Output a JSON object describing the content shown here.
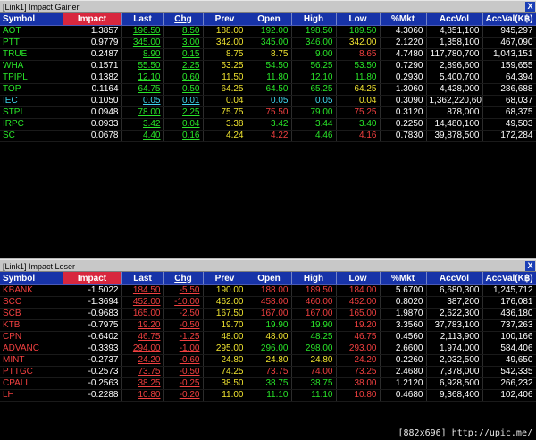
{
  "gainer": {
    "title": "[Link1] Impact Gainer",
    "close_label": "X",
    "columns": [
      "Symbol",
      "Impact",
      "Last",
      "Chg",
      "Prev",
      "Open",
      "High",
      "Low",
      "%Mkt",
      "AccVol",
      "AccVal(K฿)"
    ],
    "rows": [
      {
        "symbol": "AOT",
        "impact": "1.3857",
        "last": "196.50",
        "chg": "8.50",
        "prev": "188.00",
        "open": "192.00",
        "high": "198.50",
        "low": "189.50",
        "mkt": "4.3060",
        "vol": "4,851,100",
        "val": "945,297",
        "c": [
          "g",
          "w",
          "g",
          "g",
          "y",
          "g",
          "g",
          "g"
        ]
      },
      {
        "symbol": "PTT",
        "impact": "0.9779",
        "last": "345.00",
        "chg": "3.00",
        "prev": "342.00",
        "open": "345.00",
        "high": "346.00",
        "low": "342.00",
        "mkt": "2.1220",
        "vol": "1,358,100",
        "val": "467,090",
        "c": [
          "g",
          "w",
          "g",
          "g",
          "y",
          "g",
          "g",
          "y"
        ]
      },
      {
        "symbol": "TRUE",
        "impact": "0.2487",
        "last": "8.90",
        "chg": "0.15",
        "prev": "8.75",
        "open": "8.75",
        "high": "9.00",
        "low": "8.65",
        "mkt": "4.7480",
        "vol": "117,780,700",
        "val": "1,043,151",
        "c": [
          "g",
          "w",
          "g",
          "g",
          "y",
          "y",
          "g",
          "r"
        ]
      },
      {
        "symbol": "WHA",
        "impact": "0.1571",
        "last": "55.50",
        "chg": "2.25",
        "prev": "53.25",
        "open": "54.50",
        "high": "56.25",
        "low": "53.50",
        "mkt": "0.7290",
        "vol": "2,896,600",
        "val": "159,655",
        "c": [
          "g",
          "w",
          "g",
          "g",
          "y",
          "g",
          "g",
          "g"
        ]
      },
      {
        "symbol": "TPIPL",
        "impact": "0.1382",
        "last": "12.10",
        "chg": "0.60",
        "prev": "11.50",
        "open": "11.80",
        "high": "12.10",
        "low": "11.80",
        "mkt": "0.2930",
        "vol": "5,400,700",
        "val": "64,394",
        "c": [
          "g",
          "w",
          "g",
          "g",
          "y",
          "g",
          "g",
          "g"
        ]
      },
      {
        "symbol": "TOP",
        "impact": "0.1164",
        "last": "64.75",
        "chg": "0.50",
        "prev": "64.25",
        "open": "64.50",
        "high": "65.25",
        "low": "64.25",
        "mkt": "1.3060",
        "vol": "4,428,000",
        "val": "286,688",
        "c": [
          "g",
          "w",
          "g",
          "g",
          "y",
          "g",
          "g",
          "y"
        ]
      },
      {
        "symbol": "IEC",
        "impact": "0.1050",
        "last": "0.05",
        "chg": "0.01",
        "prev": "0.04",
        "open": "0.05",
        "high": "0.05",
        "low": "0.04",
        "mkt": "0.3090",
        "vol": "1,362,220,600",
        "val": "68,037",
        "c": [
          "c",
          "w",
          "c",
          "c",
          "y",
          "c",
          "c",
          "y"
        ]
      },
      {
        "symbol": "STPI",
        "impact": "0.0948",
        "last": "78.00",
        "chg": "2.25",
        "prev": "75.75",
        "open": "75.50",
        "high": "79.00",
        "low": "75.25",
        "mkt": "0.3120",
        "vol": "878,000",
        "val": "68,375",
        "c": [
          "g",
          "w",
          "g",
          "g",
          "y",
          "r",
          "g",
          "r"
        ]
      },
      {
        "symbol": "IRPC",
        "impact": "0.0933",
        "last": "3.42",
        "chg": "0.04",
        "prev": "3.38",
        "open": "3.42",
        "high": "3.44",
        "low": "3.40",
        "mkt": "0.2250",
        "vol": "14,480,100",
        "val": "49,503",
        "c": [
          "g",
          "w",
          "g",
          "g",
          "y",
          "g",
          "g",
          "g"
        ]
      },
      {
        "symbol": "SC",
        "impact": "0.0678",
        "last": "4.40",
        "chg": "0.16",
        "prev": "4.24",
        "open": "4.22",
        "high": "4.46",
        "low": "4.16",
        "mkt": "0.7830",
        "vol": "39,878,500",
        "val": "172,284",
        "c": [
          "g",
          "w",
          "g",
          "g",
          "y",
          "r",
          "g",
          "r"
        ]
      }
    ]
  },
  "loser": {
    "title": "[Link1] Impact Loser",
    "close_label": "X",
    "columns": [
      "Symbol",
      "Impact",
      "Last",
      "Chg",
      "Prev",
      "Open",
      "High",
      "Low",
      "%Mkt",
      "AccVol",
      "AccVal(K฿)"
    ],
    "rows": [
      {
        "symbol": "KBANK",
        "impact": "-1.5022",
        "last": "184.50",
        "chg": "-5.50",
        "prev": "190.00",
        "open": "188.00",
        "high": "189.50",
        "low": "184.00",
        "mkt": "5.6700",
        "vol": "6,680,300",
        "val": "1,245,712",
        "c": [
          "r",
          "w",
          "r",
          "r",
          "y",
          "r",
          "r",
          "r"
        ]
      },
      {
        "symbol": "SCC",
        "impact": "-1.3694",
        "last": "452.00",
        "chg": "-10.00",
        "prev": "462.00",
        "open": "458.00",
        "high": "460.00",
        "low": "452.00",
        "mkt": "0.8020",
        "vol": "387,200",
        "val": "176,081",
        "c": [
          "r",
          "w",
          "r",
          "r",
          "y",
          "r",
          "r",
          "r"
        ]
      },
      {
        "symbol": "SCB",
        "impact": "-0.9683",
        "last": "165.00",
        "chg": "-2.50",
        "prev": "167.50",
        "open": "167.00",
        "high": "167.00",
        "low": "165.00",
        "mkt": "1.9870",
        "vol": "2,622,300",
        "val": "436,180",
        "c": [
          "r",
          "w",
          "r",
          "r",
          "y",
          "r",
          "r",
          "r"
        ]
      },
      {
        "symbol": "KTB",
        "impact": "-0.7975",
        "last": "19.20",
        "chg": "-0.50",
        "prev": "19.70",
        "open": "19.90",
        "high": "19.90",
        "low": "19.20",
        "mkt": "3.3560",
        "vol": "37,783,100",
        "val": "737,263",
        "c": [
          "r",
          "w",
          "r",
          "r",
          "y",
          "g",
          "g",
          "r"
        ]
      },
      {
        "symbol": "CPN",
        "impact": "-0.6402",
        "last": "46.75",
        "chg": "-1.25",
        "prev": "48.00",
        "open": "48.00",
        "high": "48.25",
        "low": "46.75",
        "mkt": "0.4560",
        "vol": "2,113,900",
        "val": "100,166",
        "c": [
          "r",
          "w",
          "r",
          "r",
          "y",
          "y",
          "g",
          "r"
        ]
      },
      {
        "symbol": "ADVANC",
        "impact": "-0.3393",
        "last": "294.00",
        "chg": "-1.00",
        "prev": "295.00",
        "open": "296.00",
        "high": "298.00",
        "low": "293.00",
        "mkt": "2.6600",
        "vol": "1,974,000",
        "val": "584,406",
        "c": [
          "r",
          "w",
          "r",
          "r",
          "y",
          "g",
          "g",
          "r"
        ]
      },
      {
        "symbol": "MINT",
        "impact": "-0.2737",
        "last": "24.20",
        "chg": "-0.60",
        "prev": "24.80",
        "open": "24.80",
        "high": "24.80",
        "low": "24.20",
        "mkt": "0.2260",
        "vol": "2,032,500",
        "val": "49,650",
        "c": [
          "r",
          "w",
          "r",
          "r",
          "y",
          "y",
          "y",
          "r"
        ]
      },
      {
        "symbol": "PTTGC",
        "impact": "-0.2573",
        "last": "73.75",
        "chg": "-0.50",
        "prev": "74.25",
        "open": "73.75",
        "high": "74.00",
        "low": "73.25",
        "mkt": "2.4680",
        "vol": "7,378,000",
        "val": "542,335",
        "c": [
          "r",
          "w",
          "r",
          "r",
          "y",
          "r",
          "r",
          "r"
        ]
      },
      {
        "symbol": "CPALL",
        "impact": "-0.2563",
        "last": "38.25",
        "chg": "-0.25",
        "prev": "38.50",
        "open": "38.75",
        "high": "38.75",
        "low": "38.00",
        "mkt": "1.2120",
        "vol": "6,928,500",
        "val": "266,232",
        "c": [
          "r",
          "w",
          "r",
          "r",
          "y",
          "g",
          "g",
          "r"
        ]
      },
      {
        "symbol": "LH",
        "impact": "-0.2288",
        "last": "10.80",
        "chg": "-0.20",
        "prev": "11.00",
        "open": "11.10",
        "high": "11.10",
        "low": "10.80",
        "mkt": "0.4680",
        "vol": "9,368,400",
        "val": "102,406",
        "c": [
          "r",
          "w",
          "r",
          "r",
          "y",
          "g",
          "g",
          "r"
        ]
      }
    ]
  },
  "footer": "[882x696] http://upic.me/"
}
